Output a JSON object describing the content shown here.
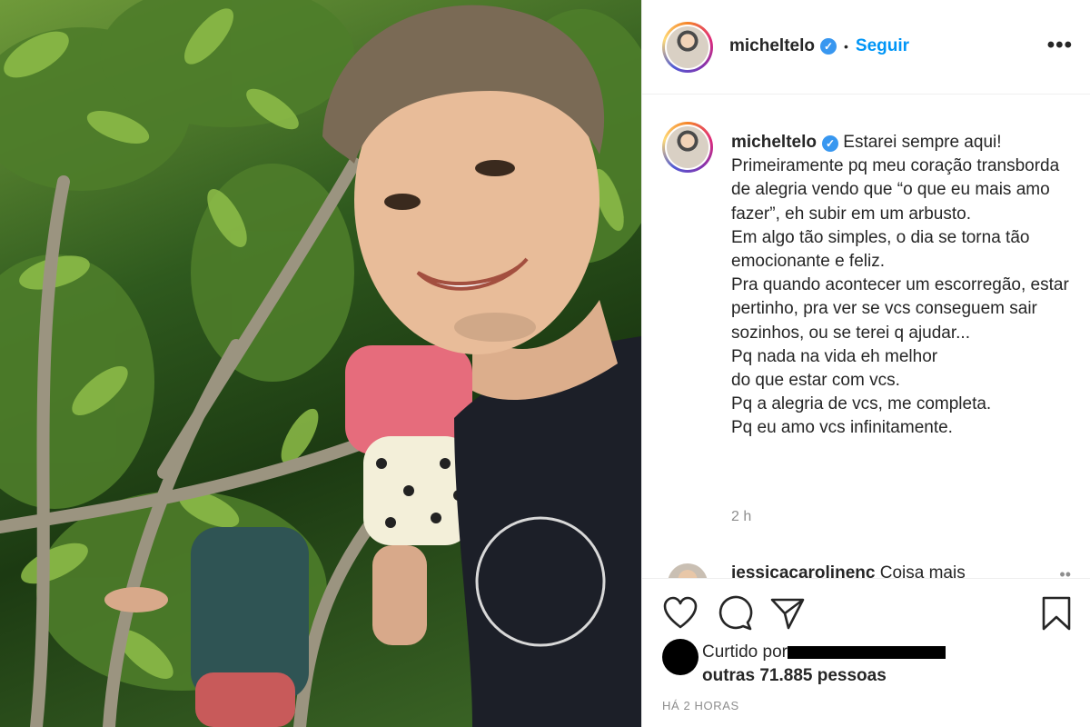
{
  "header": {
    "username": "micheltelo",
    "separator": "•",
    "follow_label": "Seguir",
    "more_icon": "more-horizontal-icon",
    "more_glyph": "•••"
  },
  "caption": {
    "username": "micheltelo",
    "text": "Estarei sempre aqui!\nPrimeiramente pq meu coração transborda de alegria vendo que “o que eu mais amo fazer”, eh subir em um arbusto.\nEm algo tão simples, o dia se torna tão emocionante e feliz.\nPra quando acontecer um escorregão, estar pertinho, pra ver se vcs conseguem sair sozinhos, ou se terei q ajudar...\nPq nada na vida eh melhor\ndo que estar com vcs.\nPq a alegria de vcs, me completa.\nPq eu amo vcs infinitamente.",
    "time_ago": "2 h"
  },
  "comment": {
    "username": "jessicacarolinenc",
    "text": "Coisa mais"
  },
  "actions": {
    "like_icon": "heart-icon",
    "comment_icon": "comment-bubble-icon",
    "share_icon": "paper-plane-icon",
    "save_icon": "bookmark-icon"
  },
  "likes": {
    "prefix": "Curtido por",
    "others": "outras 71.885 pessoas"
  },
  "posted": "HÁ 2 HORAS",
  "colors": {
    "accent": "#0095f6",
    "verified": "#3897f0",
    "muted": "#8e8e8e",
    "text": "#262626"
  }
}
